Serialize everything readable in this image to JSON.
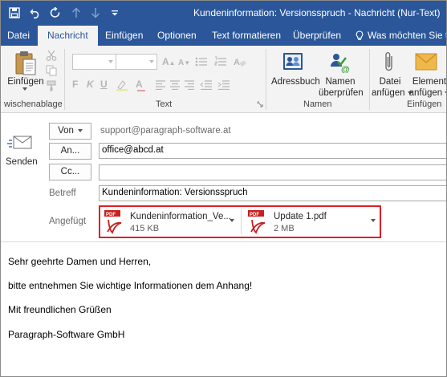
{
  "window": {
    "title": "Kundeninformation: Versionsspruch - Nachricht (Nur-Text)"
  },
  "tabs": [
    {
      "label": "Datei"
    },
    {
      "label": "Nachricht"
    },
    {
      "label": "Einfügen"
    },
    {
      "label": "Optionen"
    },
    {
      "label": "Text formatieren"
    },
    {
      "label": "Überprüfen"
    }
  ],
  "tell_me": "Was möchten Sie tun?",
  "ribbon": {
    "paste_label": "Einfügen",
    "clipboard_group": "wischenablage",
    "text_group": "Text",
    "addressbook_label": "Adressbuch",
    "check_names_label_1": "Namen",
    "check_names_label_2": "überprüfen",
    "names_group": "Namen",
    "attach_file_label_1": "Datei",
    "attach_file_label_2": "anfügen",
    "attach_item_label_1": "Element",
    "attach_item_label_2": "anfügen",
    "include_group": "Einfügen"
  },
  "header": {
    "send_label": "Senden",
    "from_label": "Von",
    "from_value": "support@paragraph-software.at",
    "to_label": "An...",
    "to_value": "office@abcd.at",
    "cc_label": "Cc...",
    "cc_value": "",
    "subject_label": "Betreff",
    "subject_value": "Kundeninformation: Versionsspruch",
    "attached_label": "Angefügt"
  },
  "attachments": [
    {
      "name": "Kundeninformation_Ve...",
      "size": "415 KB",
      "badge": "PDF"
    },
    {
      "name": "Update 1.pdf",
      "size": "2 MB",
      "badge": "PDF"
    }
  ],
  "body_lines": [
    "Sehr geehrte Damen und Herren,",
    "bitte entnehmen Sie wichtige Informationen dem Anhang!",
    "Mit freundlichen Grüßen",
    "Paragraph-Software GmbH"
  ],
  "colors": {
    "accent": "#2b579a",
    "highlight": "#e01f26",
    "pdf": "#c8201f"
  }
}
